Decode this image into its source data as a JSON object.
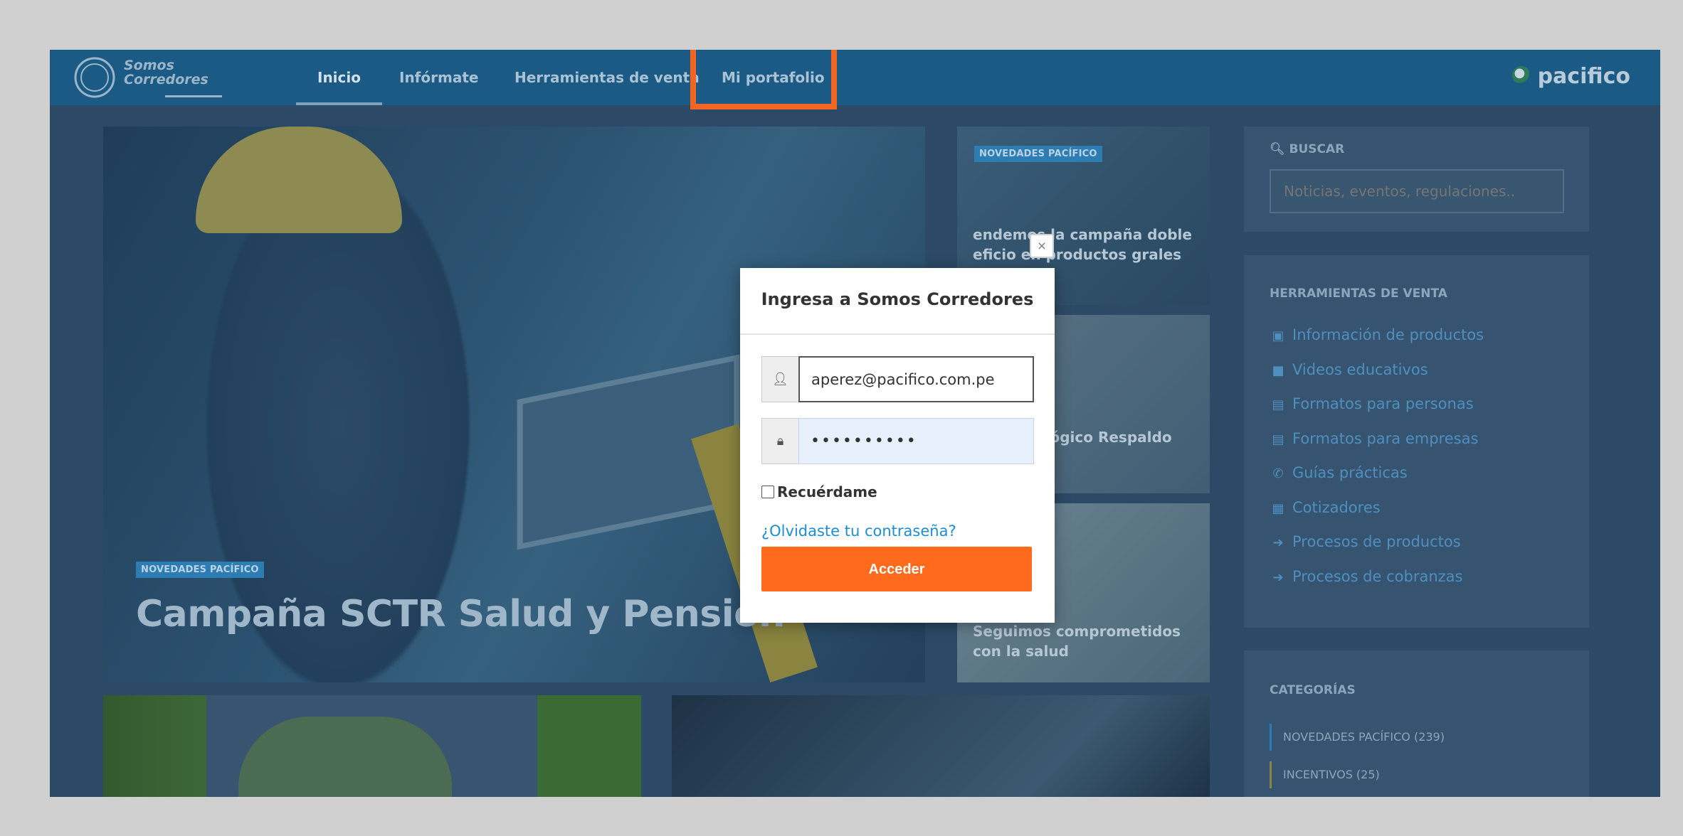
{
  "header": {
    "logo_line1": "Somos",
    "logo_line2": "Corredores",
    "nav": [
      {
        "label": "Inicio"
      },
      {
        "label": "Infórmate"
      },
      {
        "label": "Herramientas de venta"
      },
      {
        "label": "Mi portafolio"
      }
    ],
    "brand": "pacifico",
    "highlight_color": "#f26522"
  },
  "hero": {
    "tag": "NOVEDADES PACÍFICO",
    "title": "Campaña SCTR Salud y Pensión"
  },
  "cards": [
    {
      "tag": "NOVEDADES PACÍFICO",
      "title": "endemos la campaña doble eficio en productos grales de salud!"
    },
    {
      "title": "uro Oncológico Respaldo ctivo"
    },
    {
      "title": "Seguimos comprometidos con la salud"
    }
  ],
  "sidebar": {
    "search_heading": "BUSCAR",
    "search_placeholder": "Noticias, eventos, regulaciones..",
    "tools_heading": "HERRAMIENTAS DE VENTA",
    "tools": [
      {
        "label": "Información de productos",
        "icon": "image-icon"
      },
      {
        "label": "Videos educativos",
        "icon": "video-icon"
      },
      {
        "label": "Formatos para personas",
        "icon": "file-icon"
      },
      {
        "label": "Formatos para empresas",
        "icon": "file-icon"
      },
      {
        "label": "Guías prácticas",
        "icon": "phone-icon"
      },
      {
        "label": "Cotizadores",
        "icon": "calculator-icon"
      },
      {
        "label": "Procesos de productos",
        "icon": "arrow-right-icon"
      },
      {
        "label": "Procesos de cobranzas",
        "icon": "arrow-right-icon"
      }
    ],
    "categories_heading": "CATEGORÍAS",
    "categories": [
      {
        "label": "NOVEDADES PACÍFICO (239)"
      },
      {
        "label": "INCENTIVOS (25)"
      }
    ]
  },
  "login_modal": {
    "close": "×",
    "title": "Ingresa a Somos Corredores",
    "email_value": "aperez@pacifico.com.pe",
    "password_value": "••••••••••",
    "remember_label": "Recuérdame",
    "forgot_label": "¿Olvidaste tu contraseña?",
    "submit_label": "Acceder",
    "submit_color": "#ff6a1c"
  }
}
